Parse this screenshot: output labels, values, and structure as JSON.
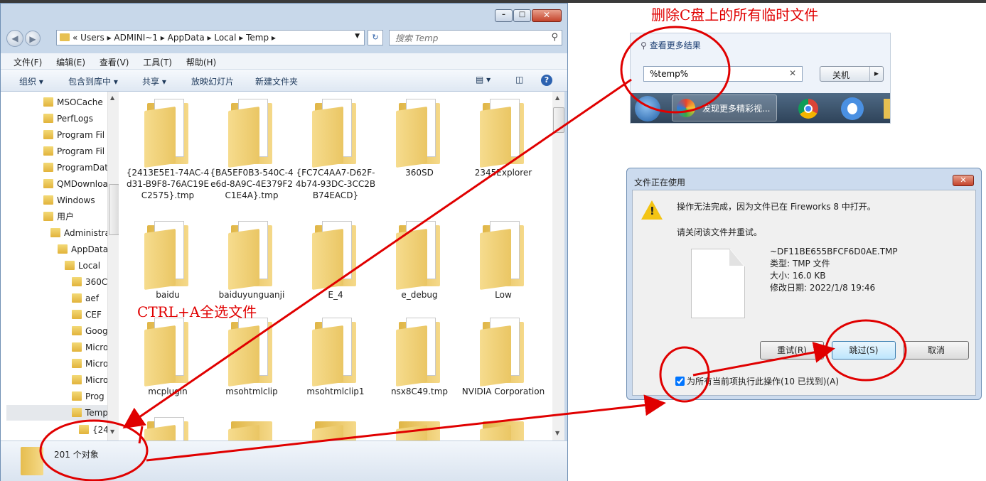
{
  "explorer": {
    "address_crumbs": "« Users ▸ ADMINI~1 ▸ AppData ▸ Local ▸ Temp ▸",
    "search_placeholder": "搜索 Temp",
    "menu": [
      "文件(F)",
      "编辑(E)",
      "查看(V)",
      "工具(T)",
      "帮助(H)"
    ],
    "toolbar": {
      "organize": "组织 ▾",
      "include": "包含到库中 ▾",
      "share": "共享 ▾",
      "slideshow": "放映幻灯片",
      "new_folder": "新建文件夹"
    },
    "nav_items": [
      {
        "label": "MSOCache"
      },
      {
        "label": "PerfLogs"
      },
      {
        "label": "Program Fil"
      },
      {
        "label": "Program Fil"
      },
      {
        "label": "ProgramDat"
      },
      {
        "label": "QMDownloa"
      },
      {
        "label": "Windows"
      },
      {
        "label": "用户"
      },
      {
        "label": "Administra"
      },
      {
        "label": "AppData"
      },
      {
        "label": "Local"
      },
      {
        "label": "360C"
      },
      {
        "label": "aef"
      },
      {
        "label": "CEF"
      },
      {
        "label": "Goog"
      },
      {
        "label": "Micro"
      },
      {
        "label": "Micro"
      },
      {
        "label": "Micro"
      },
      {
        "label": "Prog"
      },
      {
        "label": "Temp"
      },
      {
        "label": "{24"
      }
    ],
    "files": [
      "{2413E5E1-74AC-4d31-B9F8-76AC19EC2575}.tmp",
      "{BA5EF0B3-540C-4e6d-8A9C-4E379F2C1E4A}.tmp",
      "{FC7C4AA7-D62F-4b74-93DC-3CC2BB74EACD}",
      "360SD",
      "2345Explorer",
      "baidu",
      "baiduyunguanji",
      "E_4",
      "e_debug",
      "Low",
      "mcplugin",
      "msohtmlclip",
      "msohtmlclip1",
      "nsx8C49.tmp",
      "NVIDIA Corporation"
    ],
    "status_text": "201 个对象"
  },
  "taskbar": {
    "more_results": "查看更多结果",
    "search_value": "%temp%",
    "shutdown_label": "关机",
    "task_label": "发现更多精彩视..."
  },
  "dialog": {
    "title": "文件正在使用",
    "message": "操作无法完成，因为文件已在 Fireworks 8 中打开。",
    "instruction": "请关闭该文件并重试。",
    "file_name": "~DF11BE655BFCF6D0AE.TMP",
    "file_type": "类型: TMP 文件",
    "file_size": "大小: 16.0 KB",
    "file_date": "修改日期: 2022/1/8 19:46",
    "retry": "重试(R)",
    "skip": "跳过(S)",
    "cancel": "取消",
    "apply_all": "为所有当前项执行此操作(10 已找到)(A)"
  },
  "annotations": {
    "top": "删除C盘上的所有临时文件",
    "select": "CTRL+A全选文件"
  },
  "colors": {
    "annotation": "#e00000",
    "folder": "#e7c051",
    "window_frame": "#c8d8ea"
  }
}
